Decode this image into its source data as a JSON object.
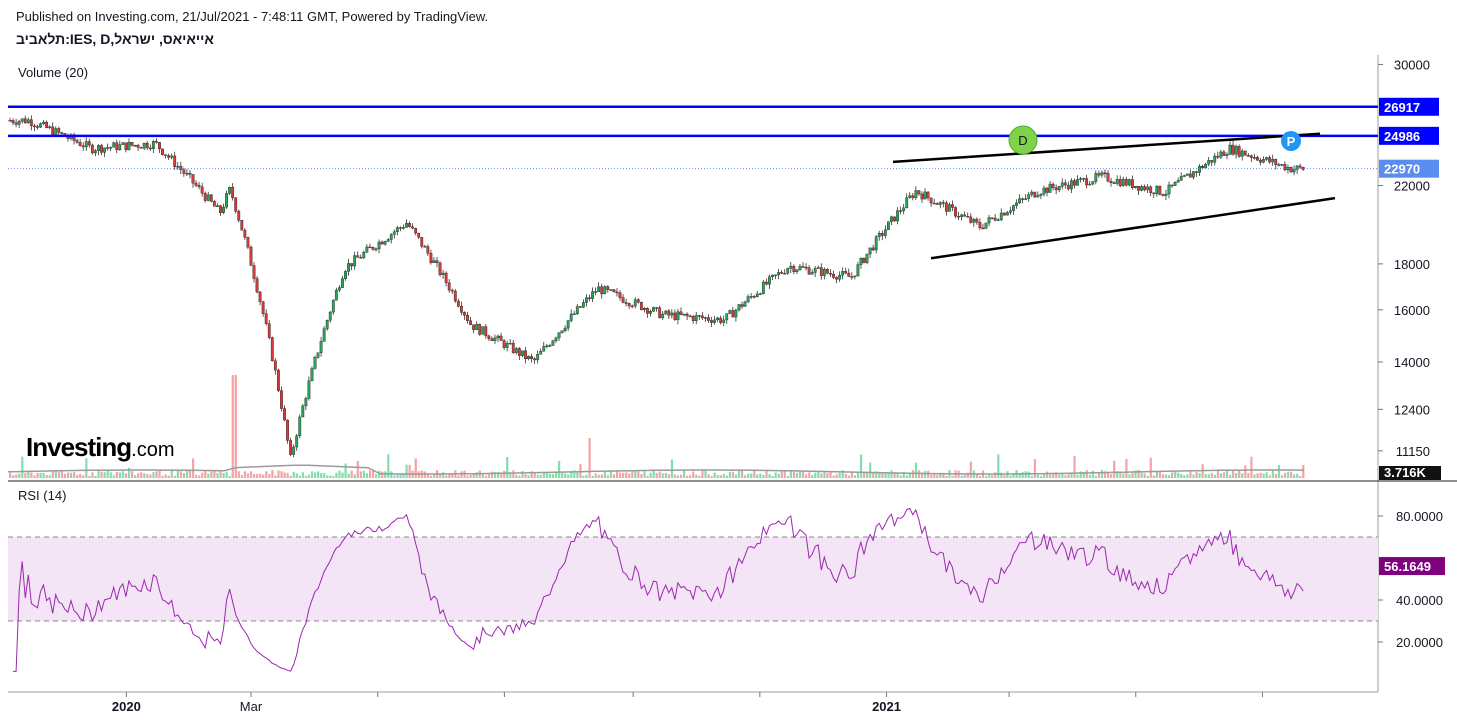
{
  "header": {
    "published": "Published on Investing.com, 21/Jul/2021 - 7:48:11 GMT, Powered by TradingView.",
    "symbol": "תלאביב:IES, D,אייאיאס, ישראל"
  },
  "panes": {
    "volume_label": "Volume (20)",
    "rsi_label": "RSI (14)"
  },
  "logo": {
    "text": "Investing",
    "suffix": ".com"
  },
  "colors": {
    "up": "#26a65b",
    "down": "#d83a3a",
    "up_volume": "#7fe0a8",
    "down_volume": "#f5a3a3",
    "resistance": "#0000ff",
    "last_price": "#5b8def",
    "rsi_line": "#9c27b0",
    "rsi_band": "#f3e5f5",
    "rsi_tag": "#800080",
    "pattern_D": "#7ed348",
    "pattern_P": "#2196f3"
  },
  "chart_data": [
    {
      "type": "candlestick",
      "price_axis": {
        "scale": "log",
        "ticks": [
          "30000",
          "22000",
          "18000",
          "16000",
          "14000",
          "12400",
          "11150"
        ],
        "tick_values": [
          30000,
          22000,
          18000,
          16000,
          14000,
          12400,
          11150
        ],
        "ylim": [
          10400,
          30500
        ]
      },
      "x_axis": {
        "labels": [
          "2020",
          "Mar",
          "2021"
        ],
        "bold_labels": [
          "2020",
          "2021"
        ]
      },
      "horizontal_levels": [
        {
          "value": 26917,
          "label": "26917"
        },
        {
          "value": 24986,
          "label": "24986"
        }
      ],
      "last_price": {
        "value": 22970,
        "label": "22970"
      },
      "volume_last": "3.716K",
      "pattern": {
        "type": "rising wedge",
        "markers": [
          "D",
          "P"
        ],
        "upper_line": [
          [
            21700,
            23400
          ],
          [
            25120,
            25500
          ]
        ],
        "lower_line": [
          [
            19150,
            19550
          ],
          [
            21300,
            21800
          ]
        ]
      },
      "series_close_approx": [
        {
          "date": "2019-11",
          "close": 26000
        },
        {
          "date": "2019-12",
          "close": 24200
        },
        {
          "date": "2020-01",
          "close": 24500
        },
        {
          "date": "2020-02",
          "close": 20500
        },
        {
          "date": "2020-02-20",
          "close": 21800
        },
        {
          "date": "2020-03-20",
          "close": 10900
        },
        {
          "date": "2020-04",
          "close": 17800
        },
        {
          "date": "2020-05",
          "close": 20000
        },
        {
          "date": "2020-06",
          "close": 15400
        },
        {
          "date": "2020-07",
          "close": 14000
        },
        {
          "date": "2020-08",
          "close": 16900
        },
        {
          "date": "2020-09",
          "close": 15800
        },
        {
          "date": "2020-10",
          "close": 15600
        },
        {
          "date": "2020-11",
          "close": 17900
        },
        {
          "date": "2020-12",
          "close": 17400
        },
        {
          "date": "2021-01",
          "close": 21700
        },
        {
          "date": "2021-02",
          "close": 19800
        },
        {
          "date": "2021-03",
          "close": 21700
        },
        {
          "date": "2021-04",
          "close": 22500
        },
        {
          "date": "2021-05",
          "close": 21600
        },
        {
          "date": "2021-06",
          "close": 24200
        },
        {
          "date": "2021-07",
          "close": 22970
        }
      ]
    },
    {
      "type": "line",
      "name": "RSI (14)",
      "y_axis": {
        "ticks": [
          "80.0000",
          "40.0000",
          "20.0000"
        ],
        "tick_values": [
          80,
          40,
          20
        ],
        "ylim": [
          0,
          90
        ]
      },
      "band": [
        30,
        70
      ],
      "last_value": {
        "value": 56.1649,
        "label": "56.1649"
      }
    }
  ]
}
